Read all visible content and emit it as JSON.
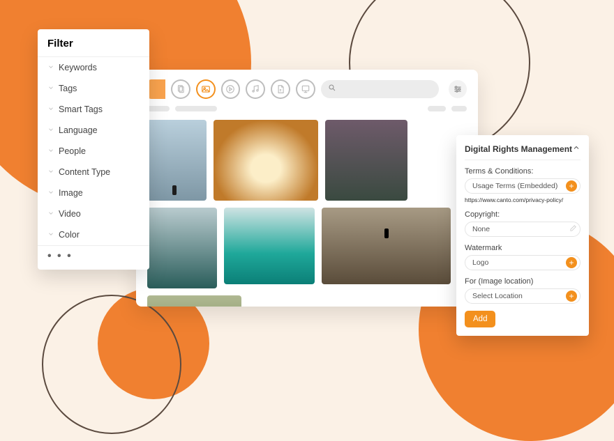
{
  "colors": {
    "accent": "#f3901d",
    "bg": "#fbf1e6"
  },
  "filter": {
    "title": "Filter",
    "items": [
      {
        "label": "Keywords"
      },
      {
        "label": "Tags"
      },
      {
        "label": "Smart Tags"
      },
      {
        "label": "Language"
      },
      {
        "label": "People"
      },
      {
        "label": "Content Type"
      },
      {
        "label": "Image"
      },
      {
        "label": "Video"
      },
      {
        "label": "Color"
      }
    ],
    "more": "• • •"
  },
  "toolbar": {
    "icons": [
      "documents",
      "images",
      "video",
      "audio",
      "pdf",
      "presentations"
    ],
    "active_index": 1,
    "search_placeholder": ""
  },
  "drm": {
    "title": "Digital Rights Management",
    "terms_label": "Terms & Conditions:",
    "terms_value": "Usage Terms (Embedded)",
    "terms_url": "https://www.canto.com/privacy-policy/",
    "copyright_label": "Copyright:",
    "copyright_value": "None",
    "watermark_label": "Watermark",
    "watermark_value": "Logo",
    "location_label": "For (Image location)",
    "location_value": "Select Location",
    "add_label": "Add"
  }
}
